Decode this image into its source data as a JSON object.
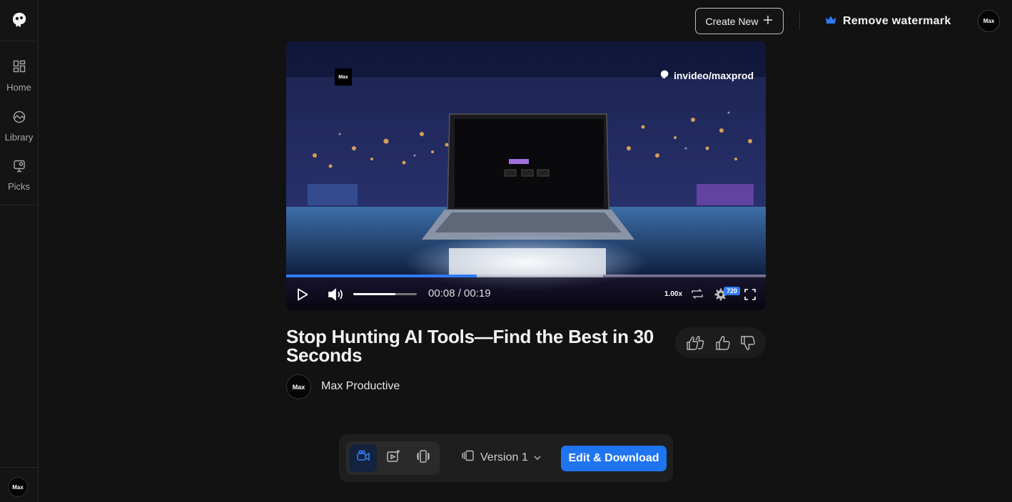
{
  "sidebar": {
    "items": [
      {
        "label": "Home",
        "icon": "grid-icon"
      },
      {
        "label": "Library",
        "icon": "library-icon"
      },
      {
        "label": "Picks",
        "icon": "picks-icon"
      }
    ],
    "avatar_text": "Max"
  },
  "header": {
    "create_label": "Create New",
    "remove_watermark_label": "Remove watermark",
    "avatar_text": "Max"
  },
  "player": {
    "watermark_text": "invideo/maxprod",
    "brand_badge_text": "Max",
    "current_time": "00:08",
    "duration": "00:19",
    "time_display": "00:08 / 00:19",
    "progress_fraction": 0.397,
    "buffer_fraction": 0.66,
    "volume_fraction": 0.66,
    "speed": "1.00x",
    "quality": "720",
    "accent_color": "#2f7cf6"
  },
  "video": {
    "title": "Stop Hunting AI Tools—Find the Best in 30 Seconds",
    "author": "Max Productive",
    "author_avatar_text": "Max"
  },
  "rating": {
    "icons": [
      "double-thumbs-up-icon",
      "thumbs-up-icon",
      "thumbs-down-icon"
    ]
  },
  "toolbar": {
    "version_label": "Version 1",
    "edit_download_label": "Edit & Download",
    "primary_color": "#1f74f0"
  }
}
